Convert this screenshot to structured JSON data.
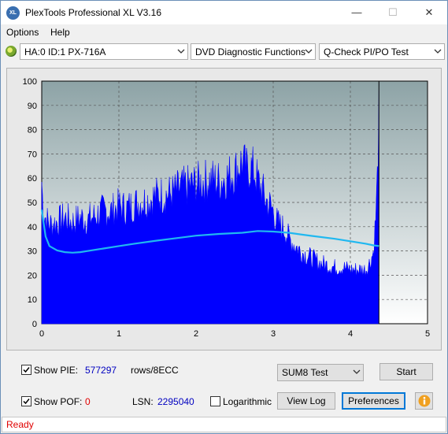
{
  "window": {
    "title": "PlexTools Professional XL V3.16",
    "icon_label": "XL",
    "minimize": "—",
    "maximize": "☐",
    "close": "✕"
  },
  "menu": {
    "options": "Options",
    "help": "Help"
  },
  "toolbar": {
    "drive": "HA:0 ID:1  PX-716A",
    "function": "DVD Diagnostic Functions",
    "test": "Q-Check PI/PO Test"
  },
  "chart_data": {
    "type": "area",
    "title": "",
    "xlabel": "",
    "ylabel": "",
    "xlim": [
      0,
      5
    ],
    "ylim": [
      0,
      100
    ],
    "x_ticks": [
      "0",
      "1",
      "2",
      "3",
      "4",
      "5"
    ],
    "y_ticks": [
      "0",
      "10",
      "20",
      "30",
      "40",
      "50",
      "60",
      "70",
      "80",
      "90",
      "100"
    ],
    "grid": true,
    "series": [
      {
        "color": "#0000ff",
        "x": [
          0.0,
          0.02,
          0.05,
          0.1,
          0.2,
          0.3,
          0.4,
          0.5,
          0.6,
          0.7,
          0.8,
          0.9,
          1.0,
          1.1,
          1.2,
          1.3,
          1.4,
          1.5,
          1.6,
          1.7,
          1.8,
          1.9,
          2.0,
          2.1,
          2.2,
          2.3,
          2.4,
          2.5,
          2.55,
          2.6,
          2.65,
          2.7,
          2.75,
          2.8,
          2.85,
          2.9,
          2.95,
          3.0,
          3.05,
          3.1,
          3.15,
          3.2,
          3.3,
          3.4,
          3.5,
          3.6,
          3.7,
          3.8,
          3.9,
          4.0,
          4.1,
          4.2,
          4.25,
          4.3,
          4.33,
          4.35,
          4.37
        ],
        "values": [
          63,
          50,
          47,
          44,
          45,
          47,
          45,
          47,
          46,
          48,
          50,
          50,
          52,
          51,
          53,
          54,
          55,
          57,
          57,
          58,
          60,
          61,
          62,
          63,
          64,
          63,
          65,
          67,
          70,
          72,
          68,
          69,
          68,
          63,
          60,
          55,
          53,
          50,
          45,
          43,
          42,
          38,
          34,
          31,
          29,
          27,
          26,
          25,
          25,
          24,
          24,
          24,
          27,
          32,
          48,
          65,
          95
        ]
      },
      {
        "color": "#20b8f0",
        "x": [
          0.0,
          0.05,
          0.1,
          0.2,
          0.3,
          0.4,
          0.5,
          0.6,
          0.8,
          1.0,
          1.2,
          1.5,
          1.8,
          2.0,
          2.3,
          2.6,
          2.8,
          3.0,
          3.2,
          3.5,
          3.8,
          4.0,
          4.2,
          4.3,
          4.37
        ],
        "values": [
          47,
          36,
          32,
          30.2,
          29.5,
          29.3,
          29.5,
          30,
          31,
          32,
          33,
          34.3,
          35.5,
          36.3,
          37,
          37.5,
          38.2,
          38,
          37.5,
          36.2,
          35,
          34,
          33,
          32.3,
          32
        ]
      }
    ],
    "end_marker_x": 4.37
  },
  "controls": {
    "show_pie_label": "Show PIE:",
    "pie_value": "577297",
    "rows_label": "rows/8ECC",
    "show_pof_label": "Show POF:",
    "pof_value": "0",
    "lsn_label": "LSN:",
    "lsn_value": "2295040",
    "logarithmic_label": "Logarithmic",
    "sum_select": "SUM8 Test",
    "start": "Start",
    "view_log": "View Log",
    "preferences": "Preferences",
    "show_pie_checked": true,
    "show_pof_checked": true,
    "logarithmic_checked": false
  },
  "status": {
    "text": "Ready"
  }
}
